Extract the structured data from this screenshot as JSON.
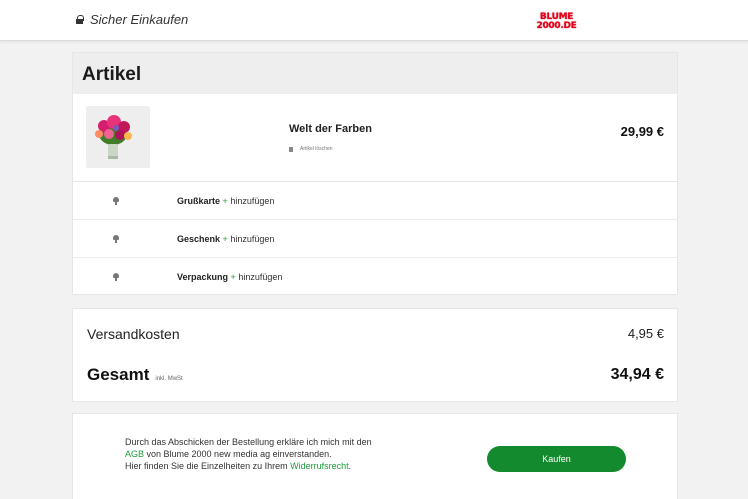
{
  "header": {
    "secure_label": "Sicher Einkaufen",
    "logo_line1": "BLUME",
    "logo_line2": "2000.DE",
    "logo_color": "#e2001a"
  },
  "cart": {
    "title": "Artikel",
    "product": {
      "name": "Welt der Farben",
      "remove_label": "Artikel löschen",
      "price": "29,99 €"
    },
    "extras": [
      {
        "name": "Grußkarte",
        "plus": "+",
        "action": "hinzufügen"
      },
      {
        "name": "Geschenk",
        "plus": "+",
        "action": "hinzufügen"
      },
      {
        "name": "Verpackung",
        "plus": "+",
        "action": "hinzufügen"
      }
    ]
  },
  "totals": {
    "shipping_label": "Versandkosten",
    "shipping_value": "4,95 €",
    "total_label": "Gesamt",
    "vat_note": "inkl. MwSt",
    "total_value": "34,94 €"
  },
  "order": {
    "legal_1": "Durch das Abschicken der Bestellung erkläre ich mich mit den",
    "agb_link": "AGB",
    "legal_2": " von Blume 2000 new media ag einverstanden.",
    "legal_3": "Hier finden Sie die Einzelheiten zu Ihrem ",
    "withdrawal_link": "Widerrufsrecht",
    "legal_4": ".",
    "buy_label": "Kaufen",
    "accent_color": "#138a2e"
  }
}
